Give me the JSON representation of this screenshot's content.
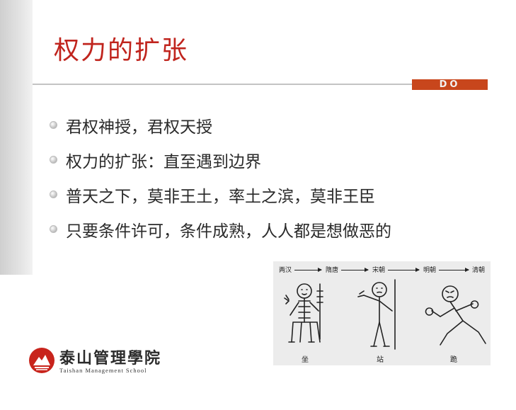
{
  "slide": {
    "title": "权力的扩张",
    "tag": "DO",
    "bullets": [
      "君权神授，君权天授",
      "权力的扩张：直至遇到边界",
      "普天之下，莫非王土，率土之滨，莫非王臣",
      "只要条件许可，条件成熟，人人都是想做恶的"
    ]
  },
  "logo": {
    "name_cn": "泰山管理學院",
    "name_en": "Taishan Management School"
  },
  "figure": {
    "eras": [
      "两汉",
      "隋唐",
      "宋朝",
      "明朝",
      "清朝"
    ],
    "poses": [
      "坐",
      "站",
      "跪"
    ]
  },
  "colors": {
    "title": "#c0241d",
    "tag_bg": "#c8461c",
    "logo": "#c8241c"
  }
}
